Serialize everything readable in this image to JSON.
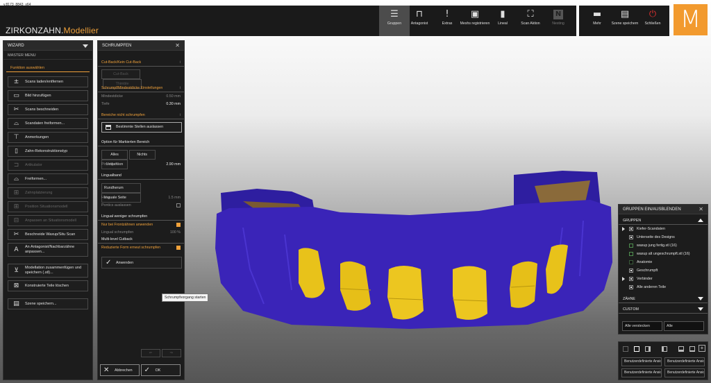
{
  "app": {
    "version": "v.8173_8843_x64",
    "brand_main": "ZIRKONZAHN.",
    "brand_accent": "Modellier",
    "logo_letter": "M",
    "accent_color": "#f0a13a"
  },
  "toolbar": [
    {
      "label": "Gruppen",
      "icon": "menu-icon"
    },
    {
      "label": "Antagonist",
      "icon": "antagonist-icon"
    },
    {
      "label": "Extras",
      "icon": "exclamation-icon"
    },
    {
      "label": "Meshs registrieren",
      "icon": "mesh-register-icon"
    },
    {
      "label": "Lineal",
      "icon": "ruler-icon"
    },
    {
      "label": "Scan Aktion",
      "icon": "scan-icon"
    },
    {
      "label": "Nesting",
      "icon": "nesting-icon"
    }
  ],
  "toolbar_right": [
    {
      "label": "Mehr",
      "icon": "more-icon"
    },
    {
      "label": "Szene speichern",
      "icon": "save-icon"
    },
    {
      "label": "Schließen",
      "icon": "power-icon"
    }
  ],
  "wizard": {
    "title": "WIZARD",
    "subtitle": "MASTER MENU",
    "section": "Funktion auswählen",
    "items": [
      {
        "label": "Scans laden/entfernen",
        "icon": "scan-load-icon"
      },
      {
        "label": "Bild hinzufügen",
        "icon": "image-add-icon"
      },
      {
        "label": "Scans beschneiden",
        "icon": "scissors-icon"
      },
      {
        "label": "Scandaten freiformen...",
        "icon": "freeform-icon"
      },
      {
        "label": "Anmerkungen",
        "icon": "annotation-icon"
      },
      {
        "label": "Zahn-Rekonstruktionstyp",
        "icon": "tooth-type-icon"
      },
      {
        "label": "Artikulator",
        "icon": "articulator-icon"
      },
      {
        "label": "Freiformen...",
        "icon": "freeform-tool-icon"
      },
      {
        "label": "Zahnplatzierung",
        "icon": "tooth-placement-icon"
      },
      {
        "label": "Position Situationsmodell",
        "icon": "position-model-icon"
      },
      {
        "label": "Anpassen an Situationsmodell",
        "icon": "adapt-model-icon"
      },
      {
        "label": "Beschneide Waxup/Situ Scan",
        "icon": "trim-waxup-icon"
      },
      {
        "label": "An Antagonist/Nachbarzähne anpassen...",
        "icon": "letter-a-icon"
      },
      {
        "label": "Modellation zusammenfügen und speichern (.stl)...",
        "icon": "merge-save-icon"
      },
      {
        "label": "Konstruierte Teile löschen",
        "icon": "delete-parts-icon"
      },
      {
        "label": "Szene speichern...",
        "icon": "scene-save-icon"
      }
    ]
  },
  "schrumpfen": {
    "title": "SCHRUMPFEN",
    "cutback_section": "Cut-Back/Kein Cut-Back",
    "cutback_label": "Cut-Back",
    "thimble_label": "Thimble",
    "shrink_section": "Schrumpf/Mindestdicke Einstellungen",
    "min_thickness_label": "Mindestdicke",
    "min_thickness_value": "0.50 mm",
    "depth_label": "Tiefe",
    "depth_value": "0.30 mm",
    "no_shrink_section": "Bereiche nicht schrumpfen",
    "skip_areas_label": "Bestimmte Stellen auslassen",
    "option_section": "Option für Markierten Bereich",
    "all_label": "Alles",
    "none_label": "Nichts",
    "invert_label": "Umkehren",
    "brush_label": "Pinselgröße",
    "brush_value": "2.90 mm",
    "lingual_section": "Lingualband",
    "around_label": "Rundherum",
    "lingual_side_label": "linguale Seite",
    "height_label": "Höhe",
    "height_value": "1.5 mm",
    "pontics_label": "Pontics auslassen",
    "lingual_less_section": "Lingual weniger schrumpfen",
    "front_teeth_label": "Nur bei Frontzähnen anwenden",
    "lingual_shrink_label": "Lingual schrumpfen",
    "lingual_shrink_value": "100 %",
    "multilevel_section": "Multi-level Cutback",
    "reduced_form_label": "Reduzierte Form erneut schrumpfen",
    "apply_label": "Anwenden",
    "tooltip": "Schrumpfvorgang starten",
    "cancel_label": "Abbrechen",
    "ok_label": "OK"
  },
  "groups": {
    "title": "GRUPPEN EIN/AUSBLENDEN",
    "section_groups": "GRUPPEN",
    "items": [
      {
        "label": "Kiefer-Scandaten",
        "expand": true,
        "checked": true
      },
      {
        "label": "Unterseite des Designs",
        "expand": false,
        "checked": true
      },
      {
        "label": "waxup jung fertig.stl (16)",
        "expand": false,
        "checked": false
      },
      {
        "label": "waxup alt ungeschrumpft.stl (16)",
        "expand": false,
        "checked": false
      },
      {
        "label": "Anatomie",
        "expand": false,
        "checked": false
      },
      {
        "label": "Geschrumpft",
        "expand": false,
        "checked": true
      },
      {
        "label": "Verbinder",
        "expand": true,
        "checked": true
      },
      {
        "label": "Alle anderen Teile",
        "expand": false,
        "checked": true
      }
    ],
    "section_teeth": "ZÄHNE",
    "section_custom": "CUSTOM",
    "hide_all_label": "Alle verstecken",
    "all_label": "Alle"
  },
  "bottom_panel": {
    "custom_a1": "Benutzerdefinierte Ansicht",
    "custom_a2": "Benutzerdefinierte Ansicht",
    "custom_b1": "Benutzerdefinierte Ansicht",
    "custom_b2": "Benutzerdefinierte Ansicht"
  },
  "model_colors": {
    "base": "#3a24b8",
    "teeth": "#e8c21a",
    "inner": "#8a6a3a"
  }
}
